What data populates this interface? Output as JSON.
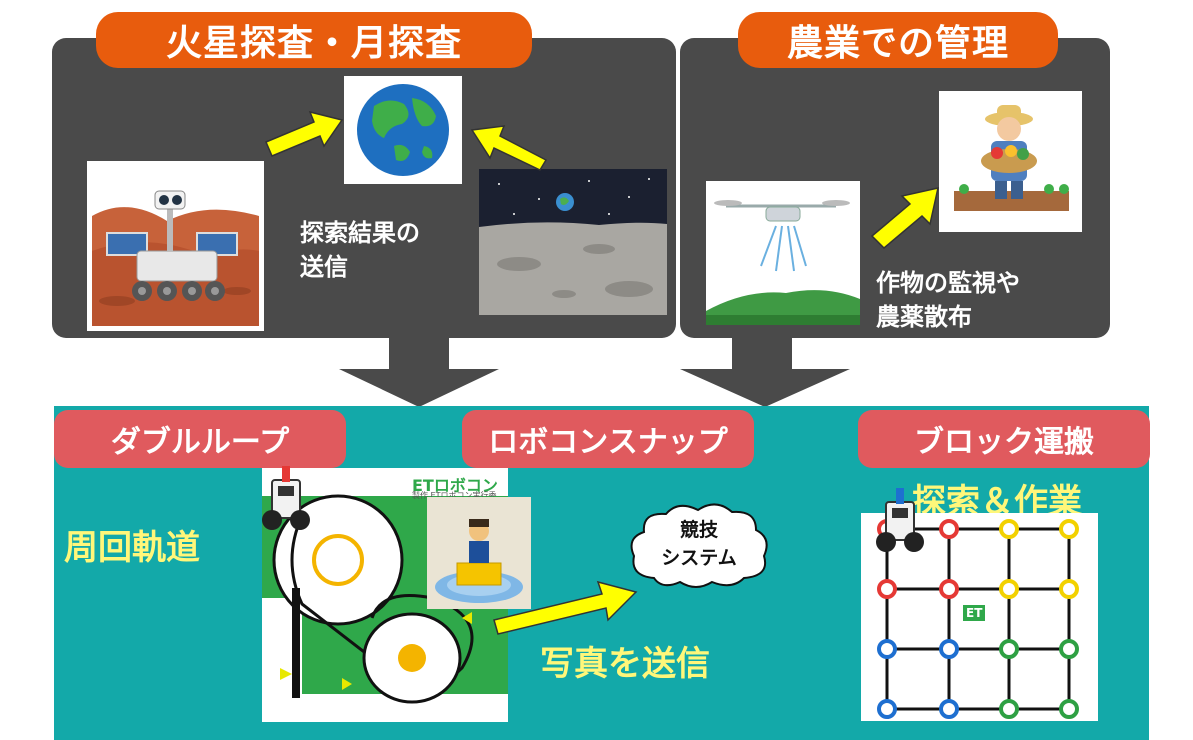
{
  "top_left": {
    "title": "火星探査・月探査",
    "caption_line1": "探索結果の",
    "caption_line2": "送信",
    "icons": [
      "mars-rover-illustration",
      "earth-illustration",
      "moon-surface-illustration"
    ]
  },
  "top_right": {
    "title": "農業での管理",
    "caption_line1": "作物の監視や",
    "caption_line2": "農薬散布",
    "icons": [
      "drone-illustration",
      "farmer-illustration"
    ]
  },
  "bottom": {
    "sections": [
      {
        "title": "ダブルループ",
        "label": "周回軌道"
      },
      {
        "title": "ロボコンスナップ",
        "label": "写真を送信"
      },
      {
        "title": "ブロック運搬",
        "label": "探索＆作業"
      }
    ],
    "cloud_line1": "競技",
    "cloud_line2": "システム",
    "course_logo": "ETロボコン",
    "course_sub": "製作 ETロボコン実行委",
    "grid_logo": "ET"
  },
  "colors": {
    "panel": "#4a4a4a",
    "orange_pill": "#e85c0d",
    "red_pill": "#e05a5e",
    "teal": "#13a9a9",
    "yellow_text": "#fff77a",
    "arrow_yellow": "#ffff00"
  }
}
